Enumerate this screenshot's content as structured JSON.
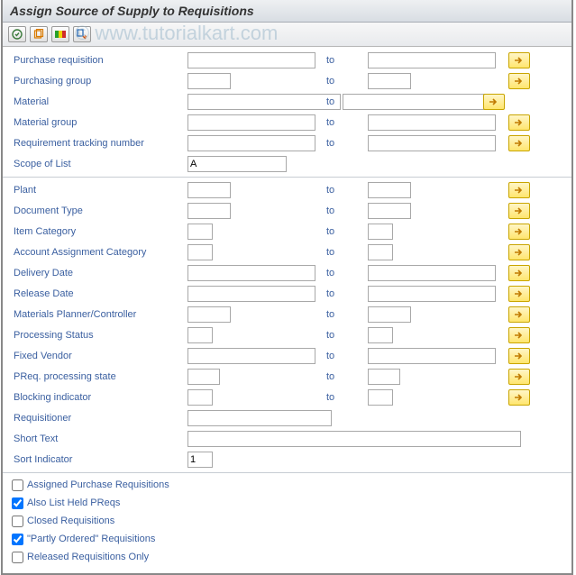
{
  "title": "Assign Source of Supply to Requisitions",
  "watermark": "© www.tutorialkart.com",
  "labels": {
    "to": "to",
    "purchase_requisition": "Purchase requisition",
    "purchasing_group": "Purchasing group",
    "material": "Material",
    "material_group": "Material group",
    "req_tracking": "Requirement tracking number",
    "scope_of_list": "Scope of List",
    "plant": "Plant",
    "document_type": "Document Type",
    "item_category": "Item Category",
    "account_assignment": "Account Assignment Category",
    "delivery_date": "Delivery Date",
    "release_date": "Release Date",
    "mrp_controller": "Materials Planner/Controller",
    "processing_status": "Processing Status",
    "fixed_vendor": "Fixed Vendor",
    "preq_state": "PReq. processing state",
    "blocking_indicator": "Blocking indicator",
    "requisitioner": "Requisitioner",
    "short_text": "Short Text",
    "sort_indicator": "Sort Indicator"
  },
  "values": {
    "scope_of_list": "A",
    "sort_indicator": "1"
  },
  "checkboxes": {
    "assigned_pr": {
      "label": "Assigned Purchase Requisitions",
      "checked": false
    },
    "held_preqs": {
      "label": "Also List Held PReqs",
      "checked": true
    },
    "closed_req": {
      "label": "Closed Requisitions",
      "checked": false
    },
    "partly_ordered": {
      "label": "\"Partly Ordered\" Requisitions",
      "checked": true
    },
    "released_only": {
      "label": "Released Requisitions Only",
      "checked": false
    }
  }
}
